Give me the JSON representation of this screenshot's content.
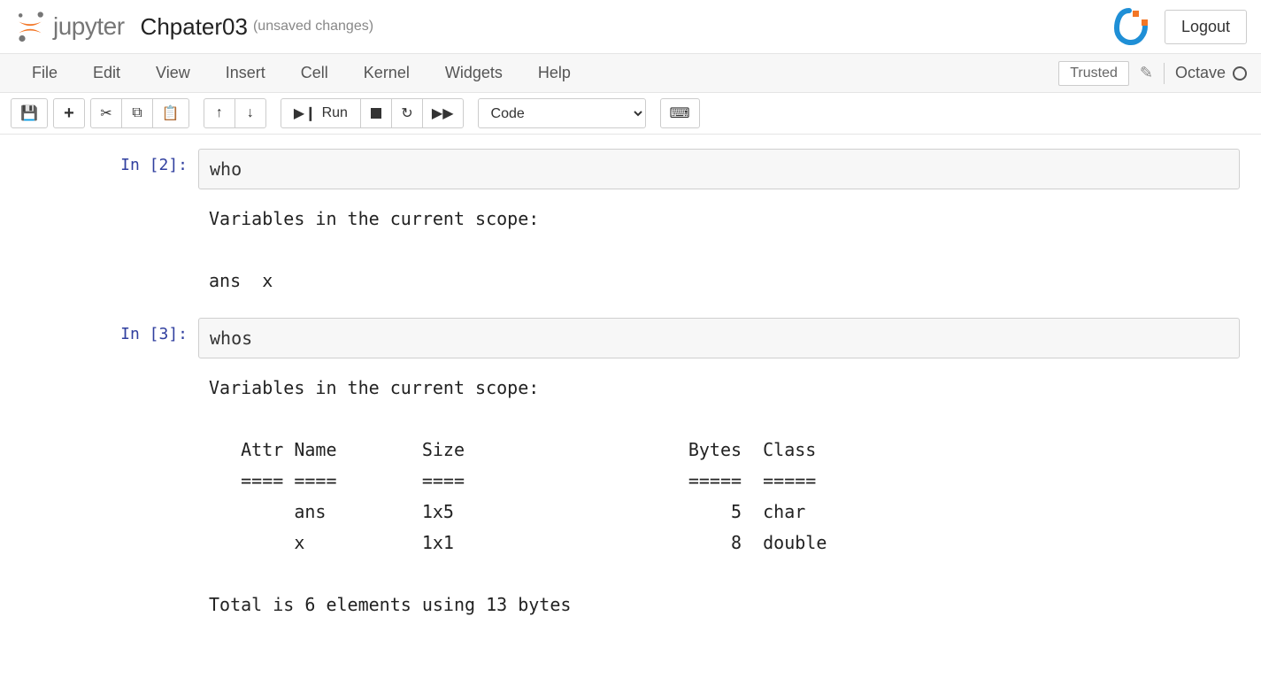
{
  "header": {
    "brand": "jupyter",
    "notebook_name": "Chpater03",
    "status": "(unsaved changes)",
    "logout": "Logout"
  },
  "menubar": {
    "items": [
      "File",
      "Edit",
      "View",
      "Insert",
      "Cell",
      "Kernel",
      "Widgets",
      "Help"
    ],
    "trusted": "Trusted",
    "kernel": "Octave"
  },
  "toolbar": {
    "run_label": "Run",
    "celltype": "Code"
  },
  "cells": [
    {
      "prompt": "In [2]:",
      "input": "who",
      "output": "Variables in the current scope:\n\nans  x\n"
    },
    {
      "prompt": "In [3]:",
      "input": "whos",
      "output": "Variables in the current scope:\n\n   Attr Name        Size                     Bytes  Class\n   ==== ====        ====                     =====  =====\n        ans         1x5                          5  char\n        x           1x1                          8  double\n\nTotal is 6 elements using 13 bytes\n"
    }
  ]
}
